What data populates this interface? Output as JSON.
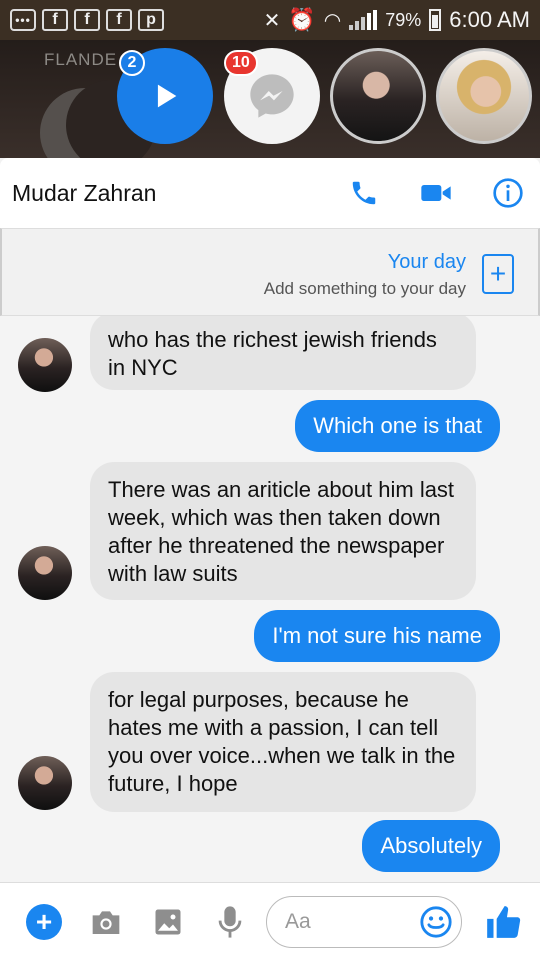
{
  "status_bar": {
    "battery": "79%",
    "time": "6:00 AM"
  },
  "chat_heads": {
    "background_text": "FLANDE",
    "play_badge": "2",
    "messenger_badge": "10"
  },
  "header": {
    "contact_name": "Mudar Zahran"
  },
  "your_day": {
    "title": "Your day",
    "subtitle": "Add something to your day"
  },
  "messages": [
    {
      "from": "them",
      "text": "who has the richest jewish friends in NYC"
    },
    {
      "from": "me",
      "text": "Which one is that"
    },
    {
      "from": "them",
      "text": "There was an ariticle about him last week, which was then taken down after he threatened the newspaper with law suits"
    },
    {
      "from": "me",
      "text": "I'm not sure his name"
    },
    {
      "from": "them",
      "text": "for legal purposes, because he hates me with a passion, I can tell you over voice...when we talk in the future, I hope"
    },
    {
      "from": "me",
      "text": "Absolutely"
    }
  ],
  "composer": {
    "placeholder": "Aa"
  },
  "colors": {
    "accent": "#1a86f0",
    "incoming_bubble": "#e5e5e5",
    "badge_red": "#e8362f"
  }
}
